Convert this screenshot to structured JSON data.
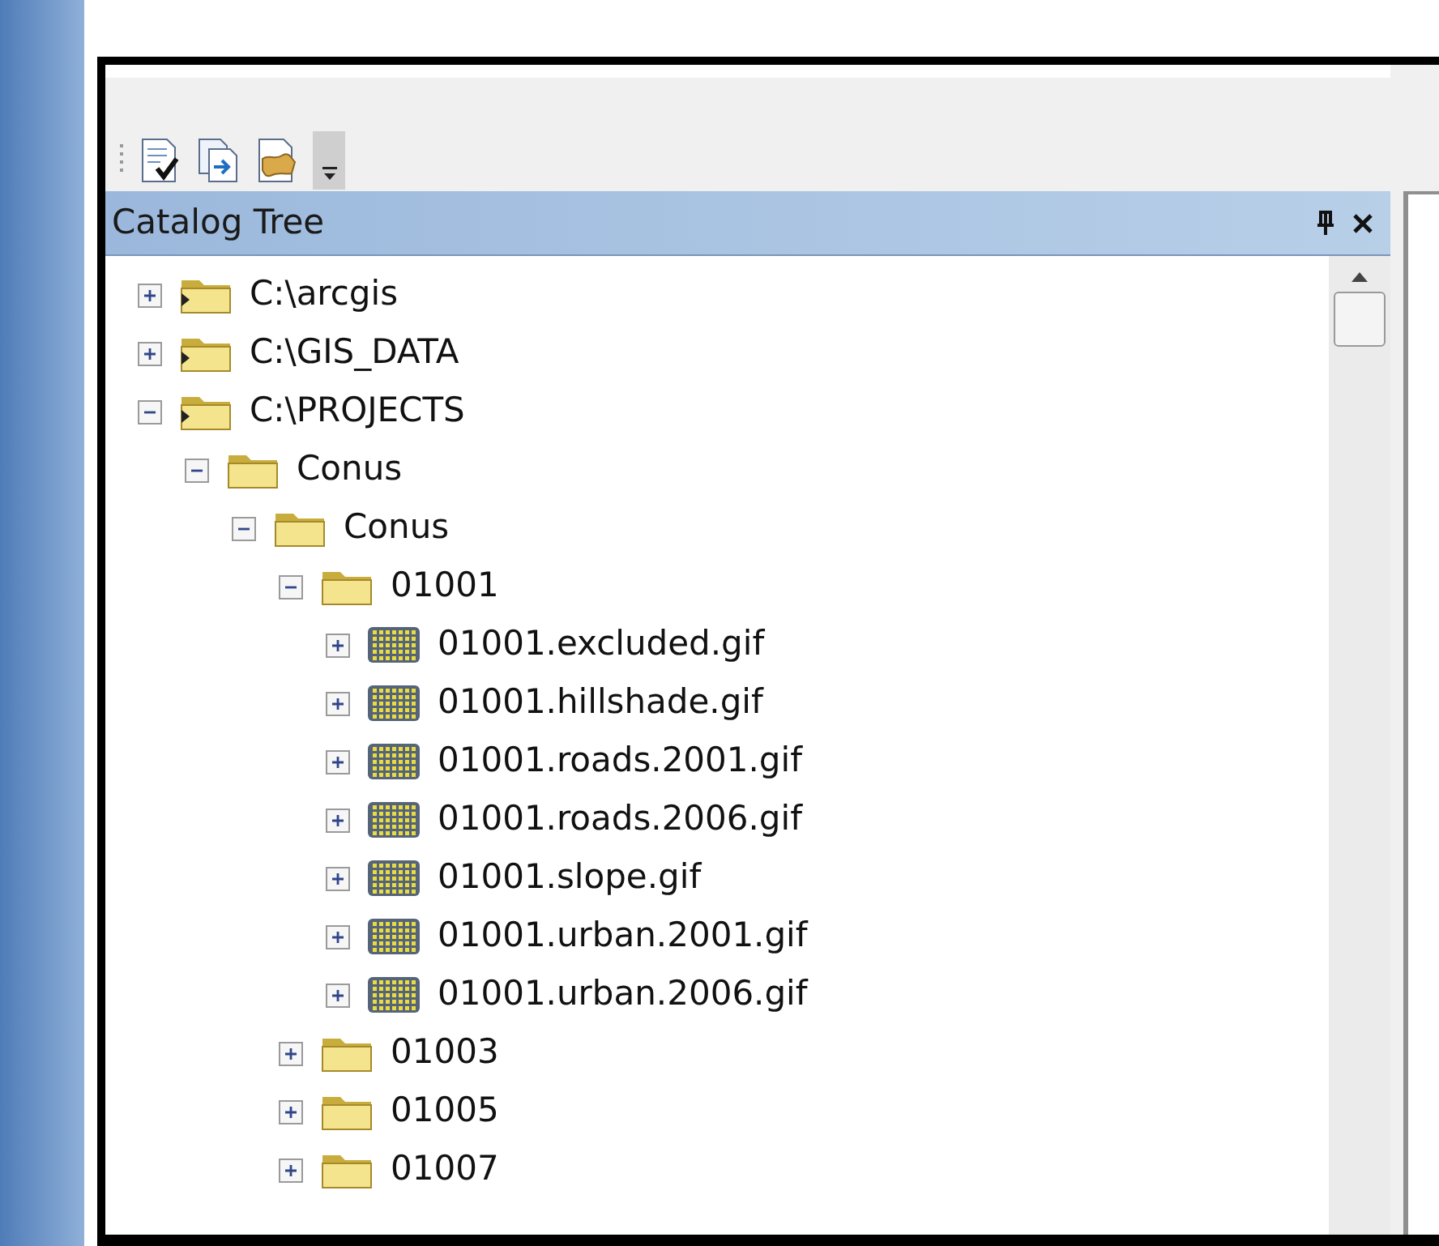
{
  "panel": {
    "title": "Catalog Tree"
  },
  "tree": [
    {
      "label": "C:\\arcgis",
      "kind": "connection",
      "expanded": false
    },
    {
      "label": "C:\\GIS_DATA",
      "kind": "connection",
      "expanded": false
    },
    {
      "label": "C:\\PROJECTS",
      "kind": "connection",
      "expanded": true,
      "children": [
        {
          "label": "Conus",
          "kind": "folder",
          "expanded": true,
          "children": [
            {
              "label": "Conus",
              "kind": "folder",
              "expanded": true,
              "children": [
                {
                  "label": "01001",
                  "kind": "folder",
                  "expanded": true,
                  "children": [
                    {
                      "label": "01001.excluded.gif",
                      "kind": "raster",
                      "expanded": false
                    },
                    {
                      "label": "01001.hillshade.gif",
                      "kind": "raster",
                      "expanded": false
                    },
                    {
                      "label": "01001.roads.2001.gif",
                      "kind": "raster",
                      "expanded": false
                    },
                    {
                      "label": "01001.roads.2006.gif",
                      "kind": "raster",
                      "expanded": false
                    },
                    {
                      "label": "01001.slope.gif",
                      "kind": "raster",
                      "expanded": false
                    },
                    {
                      "label": "01001.urban.2001.gif",
                      "kind": "raster",
                      "expanded": false
                    },
                    {
                      "label": "01001.urban.2006.gif",
                      "kind": "raster",
                      "expanded": false
                    }
                  ]
                },
                {
                  "label": "01003",
                  "kind": "folder",
                  "expanded": false
                },
                {
                  "label": "01005",
                  "kind": "folder",
                  "expanded": false
                },
                {
                  "label": "01007",
                  "kind": "folder",
                  "expanded": false
                }
              ]
            }
          ]
        }
      ]
    }
  ]
}
